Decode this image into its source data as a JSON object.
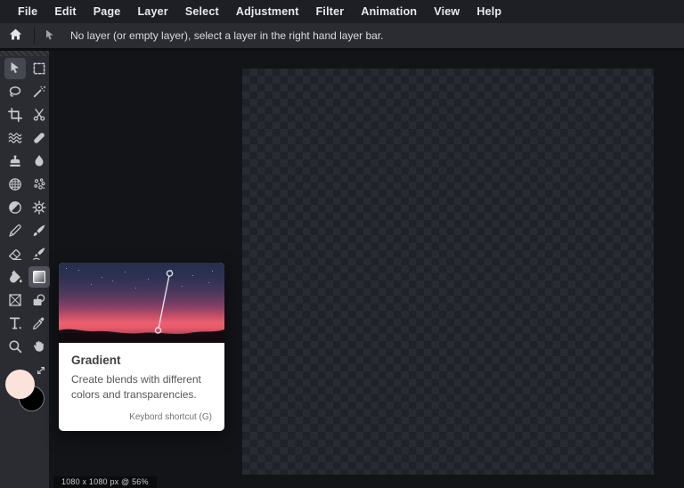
{
  "menu_bar": {
    "items": [
      "File",
      "Edit",
      "Page",
      "Layer",
      "Select",
      "Adjustment",
      "Filter",
      "Animation",
      "View",
      "Help"
    ]
  },
  "options_bar": {
    "home_icon": "home-icon",
    "active_tool_icon": "move-cursor-icon",
    "message": "No layer (or empty layer), select a layer in the right hand layer bar."
  },
  "toolbar": {
    "tools": [
      {
        "name": "move",
        "icon": "move-icon",
        "state": "selected"
      },
      {
        "name": "marquee",
        "icon": "marquee-icon",
        "state": ""
      },
      {
        "name": "lasso",
        "icon": "lasso-icon",
        "state": ""
      },
      {
        "name": "magic-wand",
        "icon": "wand-icon",
        "state": ""
      },
      {
        "name": "crop",
        "icon": "crop-icon",
        "state": ""
      },
      {
        "name": "slice",
        "icon": "scissors-icon",
        "state": ""
      },
      {
        "name": "liquify",
        "icon": "waves-icon",
        "state": ""
      },
      {
        "name": "heal",
        "icon": "bandaid-icon",
        "state": ""
      },
      {
        "name": "clone-stamp",
        "icon": "stamp-icon",
        "state": ""
      },
      {
        "name": "blur",
        "icon": "drop-icon",
        "state": ""
      },
      {
        "name": "pattern",
        "icon": "globe-grid-icon",
        "state": ""
      },
      {
        "name": "sharpen",
        "icon": "dots-cluster-icon",
        "state": ""
      },
      {
        "name": "dodge-burn",
        "icon": "contrast-circle-icon",
        "state": ""
      },
      {
        "name": "adjust",
        "icon": "gear-sun-icon",
        "state": ""
      },
      {
        "name": "pen",
        "icon": "pen-icon",
        "state": ""
      },
      {
        "name": "draw",
        "icon": "brush-icon",
        "state": ""
      },
      {
        "name": "eraser",
        "icon": "eraser-icon",
        "state": ""
      },
      {
        "name": "smudge",
        "icon": "smudge-brush-icon",
        "state": ""
      },
      {
        "name": "fill",
        "icon": "bucket-icon",
        "state": ""
      },
      {
        "name": "gradient",
        "icon": "gradient-icon",
        "state": "hovered"
      },
      {
        "name": "frame",
        "icon": "frame-icon",
        "state": ""
      },
      {
        "name": "shape",
        "icon": "shape-icon",
        "state": ""
      },
      {
        "name": "text",
        "icon": "text-icon",
        "state": ""
      },
      {
        "name": "picker",
        "icon": "eyedropper-icon",
        "state": ""
      },
      {
        "name": "zoom",
        "icon": "magnifier-icon",
        "state": ""
      },
      {
        "name": "hand",
        "icon": "hand-icon",
        "state": ""
      }
    ],
    "colors": {
      "foreground": "#FBE3DC",
      "background": "#000000"
    },
    "swap_icon": "swap-colors-icon"
  },
  "tooltip": {
    "title": "Gradient",
    "description": "Create blends with different colors and transparencies.",
    "shortcut": "Keybord shortcut (G)"
  },
  "status": {
    "dimensions": "1080 x 1080 px @ 56%"
  },
  "canvas": {
    "checker_dark": "#1F2228",
    "checker_light": "#282B32"
  }
}
